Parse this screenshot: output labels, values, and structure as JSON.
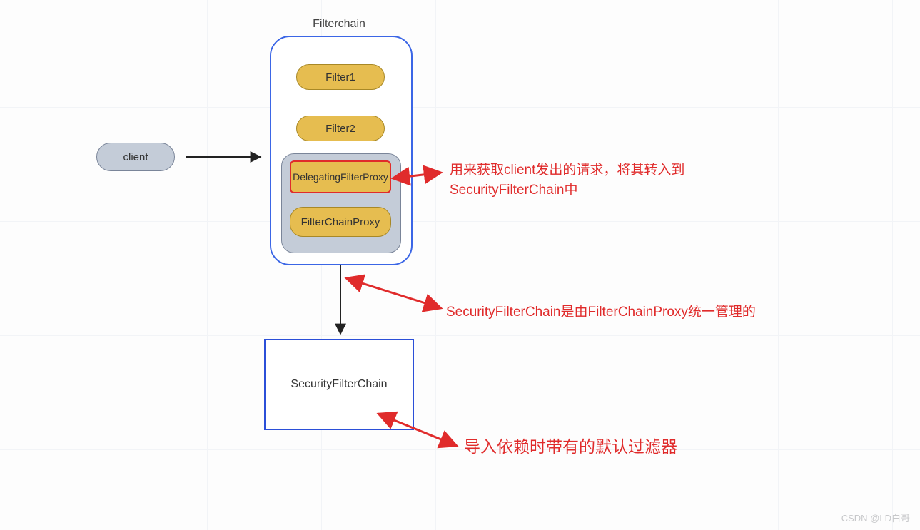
{
  "title": "Filterchain",
  "client": "client",
  "filters": {
    "f1": "Filter1",
    "f2": "Filter2",
    "dfp": "DelegatingFilterProxy",
    "fcp": "FilterChainProxy"
  },
  "sfc": "SecurityFilterChain",
  "annotations": {
    "a1": "用来获取client发出的请求，将其转入到SecurityFilterChain中",
    "a2": "SecurityFilterChain是由FilterChainProxy统一管理的",
    "a3": "导入依赖时带有的默认过滤器"
  },
  "watermark": "CSDN @LD白哥",
  "colors": {
    "red": "#e02b2b",
    "blue": "#3b66e6",
    "yellow": "#e6bd50",
    "grey": "#c4ccd8"
  }
}
